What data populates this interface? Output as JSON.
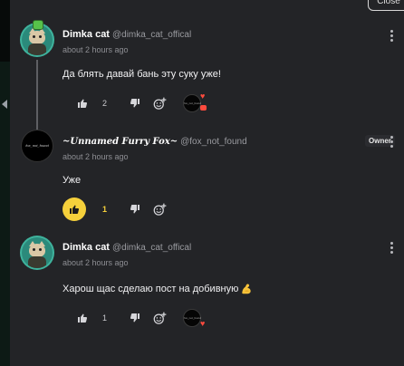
{
  "top_button_label": "Close",
  "comments": [
    {
      "author": "Dimka cat",
      "handle": "@dimka_cat_offical",
      "time": "about 2 hours ago",
      "text": "Да блять давай бань эту суку уже!",
      "likes": "2",
      "reaction_label": "fox_not_found"
    },
    {
      "author": "~Unnamed Furry Fox~",
      "handle": "@fox_not_found",
      "role": "Owner",
      "avatar_text": "fox_not_found",
      "time": "about 2 hours ago",
      "text": "Уже",
      "likes": "1"
    },
    {
      "author": "Dimka cat",
      "handle": "@dimka_cat_offical",
      "time": "about 2 hours ago",
      "text": "Харош щас сделаю пост на добивную",
      "likes": "1",
      "reaction_label": "fox_not_found"
    }
  ],
  "colors": {
    "background": "#232427",
    "accent_like": "#f5d03b",
    "heart": "#ff4b3e",
    "avatar_ring": "#3fb39d"
  },
  "icons": [
    "thumbs-up-icon",
    "thumbs-down-icon",
    "add-reaction-icon",
    "more-vert-icon",
    "heart-icon",
    "flexed-biceps-icon"
  ]
}
